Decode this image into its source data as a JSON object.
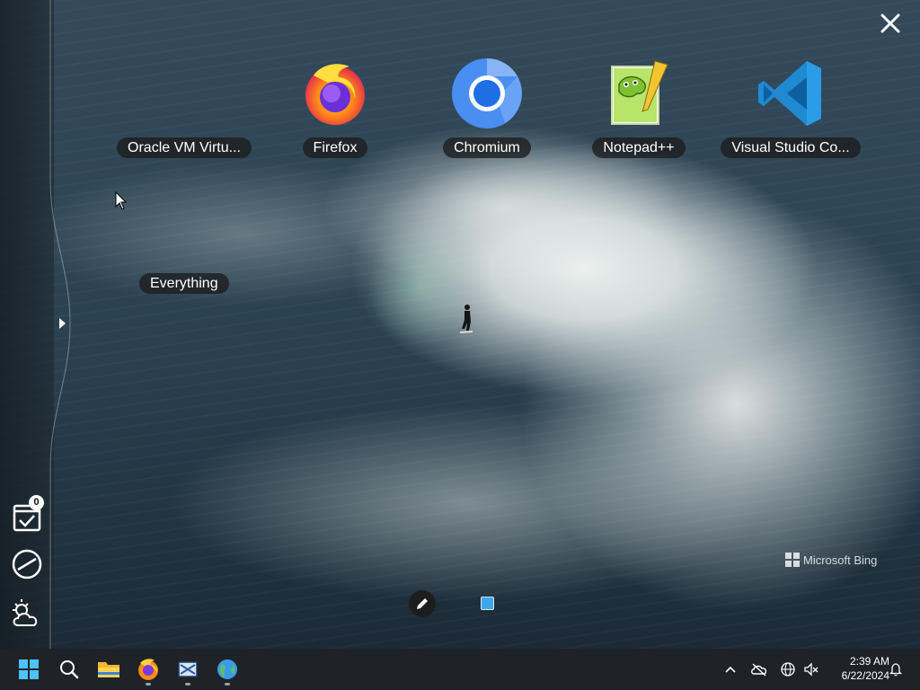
{
  "desktop": {
    "apps": [
      {
        "label": "Oracle VM Virtu...",
        "icon": "virtualbox-icon"
      },
      {
        "label": "Firefox",
        "icon": "firefox-icon"
      },
      {
        "label": "Chromium",
        "icon": "chromium-icon"
      },
      {
        "label": "Notepad++",
        "icon": "notepadpp-icon"
      },
      {
        "label": "Visual Studio Co...",
        "icon": "vscode-icon"
      }
    ],
    "extra_label": "Everything",
    "watermark": "Microsoft Bing"
  },
  "side_panel": {
    "tasks_badge": "0",
    "icons": [
      "tasks-icon",
      "speedometer-icon",
      "weather-icon"
    ]
  },
  "taskbar": {
    "pinned": [
      "start-icon",
      "search-icon",
      "file-explorer-icon",
      "firefox-icon",
      "virtualbox-icon",
      "browser-globe-icon"
    ],
    "tray": [
      "chevron-up-icon",
      "onedrive-offline-icon",
      "network-icon",
      "speaker-muted-icon",
      "notification-bell-icon"
    ],
    "time": "2:39 AM",
    "date": "6/22/2024"
  },
  "colors": {
    "taskbar": "#1f2227",
    "label_bg": "#1c1c1c",
    "accent_blue": "#3ea7ea",
    "vscode_blue": "#1f8ad2"
  }
}
